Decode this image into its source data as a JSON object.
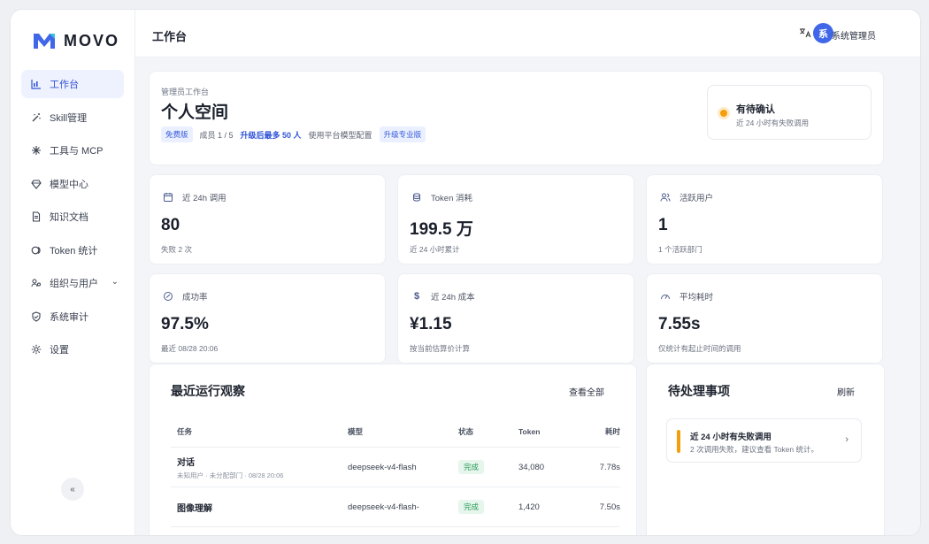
{
  "app": {
    "logo_text": "MOVO",
    "brand_color": "#3f67e8"
  },
  "sidebar": {
    "items": [
      {
        "label": "工作台",
        "icon": "chart-icon",
        "active": true
      },
      {
        "label": "Skill管理",
        "icon": "magic-wand-icon"
      },
      {
        "label": "工具与 MCP",
        "icon": "tools-icon"
      },
      {
        "label": "模型中心",
        "icon": "diamond-icon"
      },
      {
        "label": "知识文档",
        "icon": "document-icon"
      },
      {
        "label": "Token 统计",
        "icon": "token-icon"
      },
      {
        "label": "组织与用户",
        "icon": "org-icon",
        "has_submenu": true
      },
      {
        "label": "系统审计",
        "icon": "shield-icon"
      },
      {
        "label": "设置",
        "icon": "gear-icon"
      }
    ],
    "collapse_label": "«"
  },
  "header": {
    "title": "工作台",
    "avatar_initial": "系",
    "user_name": "系统管理员"
  },
  "workspace": {
    "subtitle": "管理员工作台",
    "title": "个人空间",
    "plan_tag": "免费版",
    "members": "成员 1 / 5",
    "upgrade_hint": "升级后最多 50 人",
    "model_config": "使用平台模型配置",
    "upgrade_tag": "升级专业版",
    "pending": {
      "title": "有待确认",
      "desc": "近 24 小时有失败调用"
    }
  },
  "stats": [
    {
      "label": "近 24h 调用",
      "icon": "calendar-icon",
      "value": "80",
      "note": "失败 2 次"
    },
    {
      "label": "Token 消耗",
      "icon": "coins-icon",
      "value": "199.5 万",
      "note": "近 24 小时累计"
    },
    {
      "label": "活跃用户",
      "icon": "users-icon",
      "value": "1",
      "note": "1 个活跃部门"
    },
    {
      "label": "成功率",
      "icon": "check-circle-icon",
      "value": "97.5%",
      "note": "最近 08/28 20:06"
    },
    {
      "label": "近 24h 成本",
      "icon": "dollar-icon",
      "value": "¥1.15",
      "note": "按当前估算价计算"
    },
    {
      "label": "平均耗时",
      "icon": "gauge-icon",
      "value": "7.55s",
      "note": "仅统计有起止时间的调用"
    }
  ],
  "runs": {
    "title": "最近运行观察",
    "view_all": "查看全部",
    "columns": [
      "任务",
      "模型",
      "状态",
      "Token",
      "耗时"
    ],
    "rows": [
      {
        "task": "对话",
        "meta": "未知用户 · 未分配部门 · 08/28 20:06",
        "model": "deepseek-v4-flash",
        "status": "完成",
        "token": "34,080",
        "time": "7.78s"
      },
      {
        "task": "图像理解",
        "meta": "",
        "model": "deepseek-v4-flash-",
        "status": "完成",
        "token": "1,420",
        "time": "7.50s"
      }
    ]
  },
  "todo": {
    "title": "待处理事项",
    "refresh": "刷新",
    "items": [
      {
        "title": "近 24 小时有失败调用",
        "desc": "2 次调用失败，建议查看 Token 统计。"
      }
    ]
  }
}
